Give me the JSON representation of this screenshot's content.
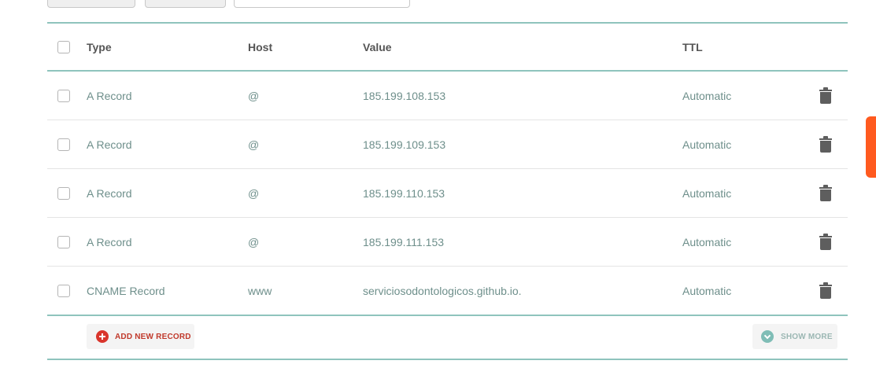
{
  "table": {
    "headers": {
      "type": "Type",
      "host": "Host",
      "value": "Value",
      "ttl": "TTL"
    },
    "rows": [
      {
        "type": "A Record",
        "host": "@",
        "value": "185.199.108.153",
        "ttl": "Automatic"
      },
      {
        "type": "A Record",
        "host": "@",
        "value": "185.199.109.153",
        "ttl": "Automatic"
      },
      {
        "type": "A Record",
        "host": "@",
        "value": "185.199.110.153",
        "ttl": "Automatic"
      },
      {
        "type": "A Record",
        "host": "@",
        "value": "185.199.111.153",
        "ttl": "Automatic"
      },
      {
        "type": "CNAME Record",
        "host": "www",
        "value": "serviciosodontologicos.github.io.",
        "ttl": "Automatic"
      }
    ]
  },
  "footer": {
    "add_label": "ADD NEW RECORD",
    "more_label": "SHOW MORE"
  },
  "icons": {
    "row_action": "trash-icon",
    "add": "plus-circle-icon",
    "more": "chevron-down-icon"
  },
  "colors": {
    "accent_rule": "#8fc4bd",
    "add_red": "#d9352c",
    "side_tab": "#ff5a1f"
  }
}
